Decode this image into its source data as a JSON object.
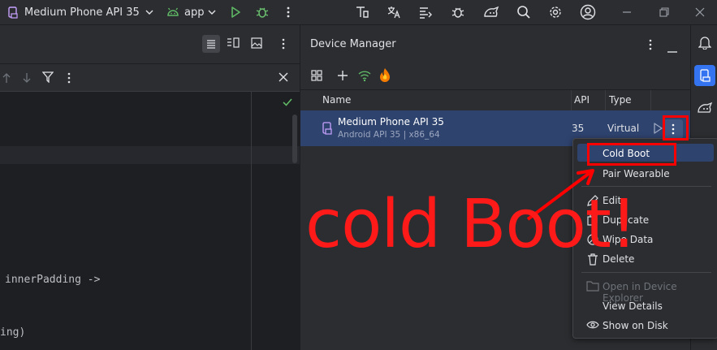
{
  "toolbar": {
    "device_selector": "Medium Phone API 35",
    "run_config": "app"
  },
  "editor": {
    "code_lines": [
      {
        "text": "innerPadding ->"
      },
      {
        "text": "ing)"
      }
    ]
  },
  "device_manager": {
    "title": "Device Manager",
    "columns": {
      "name": "Name",
      "api": "API",
      "type": "Type"
    },
    "device": {
      "name": "Medium Phone API 35",
      "subtitle": "Android API 35 | x86_64",
      "api": "35",
      "type": "Virtual"
    }
  },
  "context_menu": {
    "items": [
      {
        "label": "Cold Boot",
        "icon": "none"
      },
      {
        "label": "Pair Wearable",
        "icon": "none"
      },
      {
        "label": "Edit",
        "icon": "pencil-icon"
      },
      {
        "label": "Duplicate",
        "icon": "copy-icon"
      },
      {
        "label": "Wipe Data",
        "icon": "block-icon"
      },
      {
        "label": "Delete",
        "icon": "trash-icon"
      },
      {
        "label": "Open in Device Explorer",
        "icon": "folder-icon",
        "disabled": true
      },
      {
        "label": "View Details",
        "icon": "none"
      },
      {
        "label": "Show on Disk",
        "icon": "eye-icon"
      }
    ]
  },
  "annotation": {
    "text": "cold Boot!",
    "color": "#ff0000"
  },
  "colors": {
    "accent": "#3574f0",
    "selected_row": "#2e436e",
    "run_green": "#5fb865",
    "debug_green": "#6bc06f"
  }
}
